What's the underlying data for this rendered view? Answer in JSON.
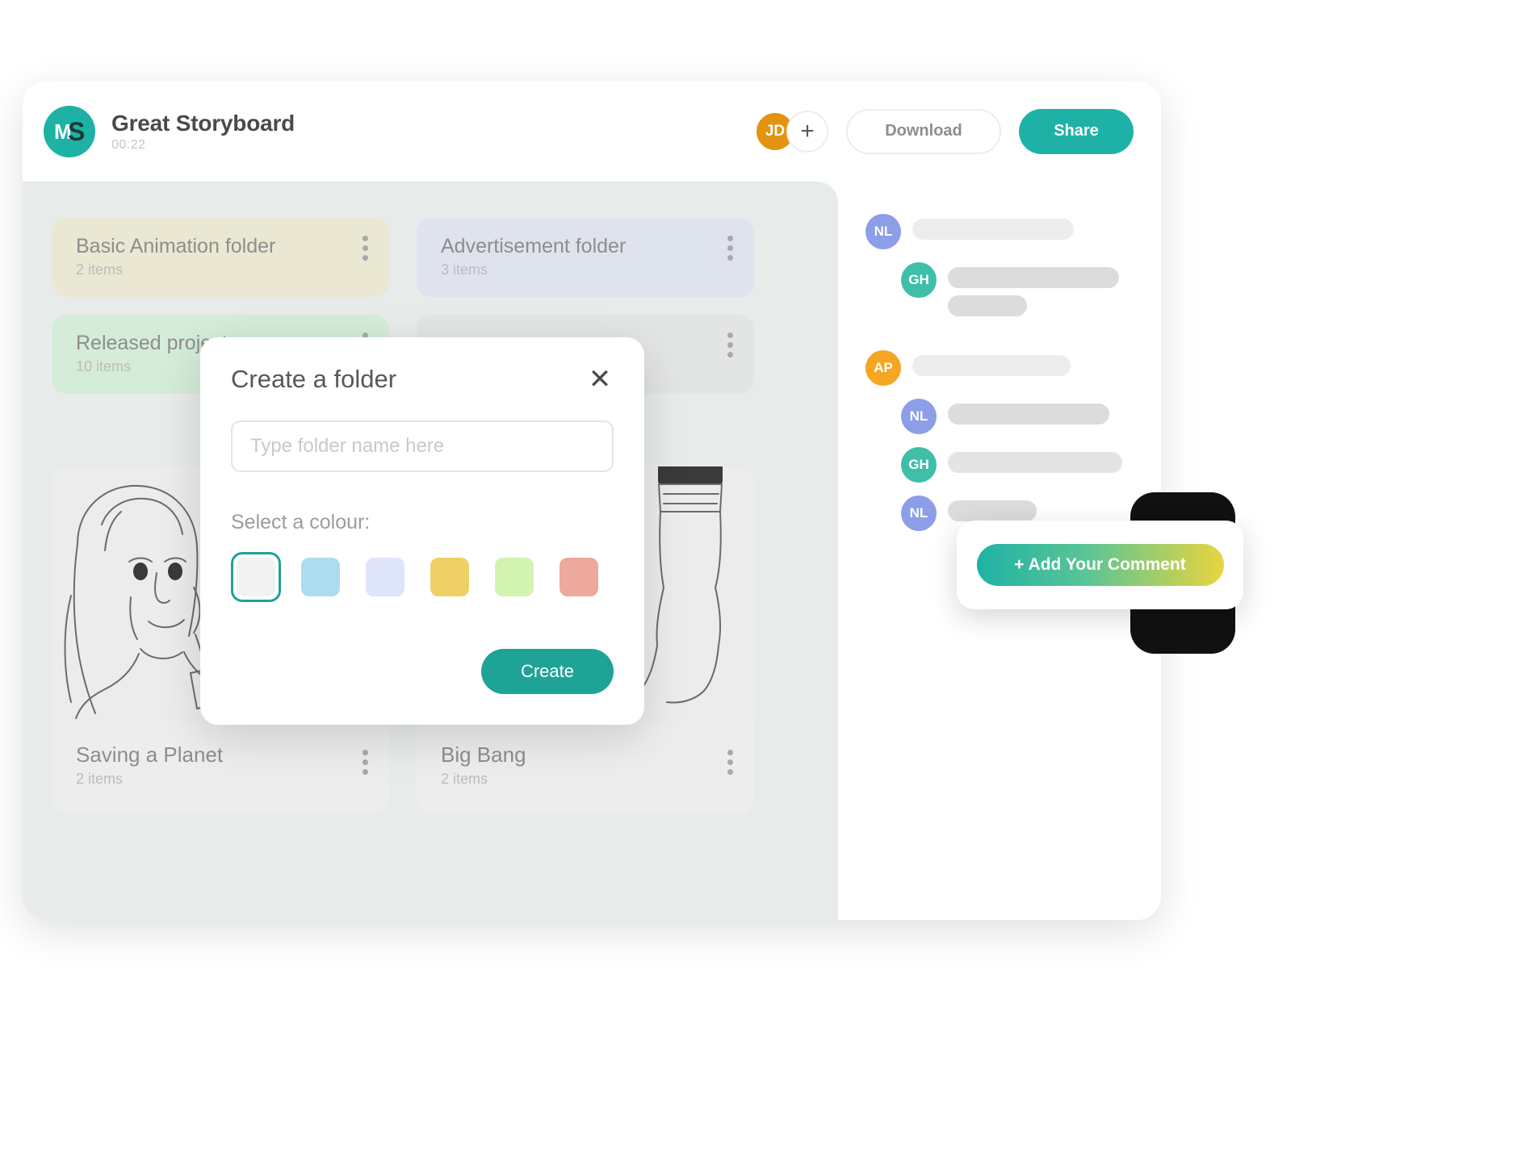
{
  "window": {
    "dots": [
      "dot-1",
      "dot-2",
      "dot-3"
    ]
  },
  "header": {
    "logo_mark_left": "M",
    "logo_mark_right": "S",
    "title": "Great Storyboard",
    "subtitle": "00:22",
    "avatar_initials": "JD",
    "add_member_icon": "+",
    "download_label": "Download",
    "share_label": "Share"
  },
  "workspace": {
    "folders": [
      {
        "name": "Basic Animation folder",
        "count": "2 items",
        "color": "#EAE8D2",
        "menu_icon": "kebab-menu-icon"
      },
      {
        "name": "Advertisement folder",
        "count": "3 items",
        "color": "#DEE3EE",
        "menu_icon": "kebab-menu-icon"
      },
      {
        "name": "Released projects",
        "count": "10 items",
        "color": "#D5ECD9",
        "menu_icon": "kebab-menu-icon"
      },
      {
        "name": "",
        "count": "",
        "color": "#E3E5E4",
        "menu_icon": "kebab-menu-icon"
      }
    ],
    "projects": [
      {
        "name": "Saving a Planet",
        "count": "2 items",
        "thumb": "sketch-woman-portrait",
        "menu_icon": "kebab-menu-icon"
      },
      {
        "name": "Big Bang",
        "count": "2 items",
        "thumb": "sketch-hand-paintbrush",
        "menu_icon": "kebab-menu-icon"
      }
    ]
  },
  "comments": {
    "items": [
      {
        "initials": "NL",
        "color": "#8C9EE8",
        "indent": 0,
        "bars": [
          200
        ]
      },
      {
        "initials": "GH",
        "color": "#3FBFA8",
        "indent": 1,
        "bars": [
          212,
          98
        ]
      },
      {
        "initials": "AP",
        "color": "#F5A623",
        "indent": 0,
        "bars": [
          196
        ]
      },
      {
        "initials": "NL",
        "color": "#8C9EE8",
        "indent": 1,
        "bars": [
          200
        ]
      },
      {
        "initials": "GH",
        "color": "#3FBFA8",
        "indent": 1,
        "bars": [
          216
        ]
      },
      {
        "initials": "NL",
        "color": "#8C9EE8",
        "indent": 1,
        "bars": [
          110
        ]
      }
    ],
    "add_comment_label": "+ Add Your Comment"
  },
  "modal": {
    "title": "Create a folder",
    "close_icon": "close-icon",
    "input_value": "",
    "input_placeholder": "Type folder name here",
    "colour_label": "Select a colour:",
    "swatches": [
      {
        "name": "white",
        "hex": "#F2F2F2",
        "selected": true
      },
      {
        "name": "blue",
        "hex": "#ADDCF0",
        "selected": false
      },
      {
        "name": "lavender",
        "hex": "#DFE5FB",
        "selected": false
      },
      {
        "name": "yellow",
        "hex": "#EFD067",
        "selected": false
      },
      {
        "name": "green",
        "hex": "#D3F3B0",
        "selected": false
      },
      {
        "name": "salmon",
        "hex": "#EDA99B",
        "selected": false
      }
    ],
    "create_label": "Create",
    "accent_color": "#1EA396"
  }
}
